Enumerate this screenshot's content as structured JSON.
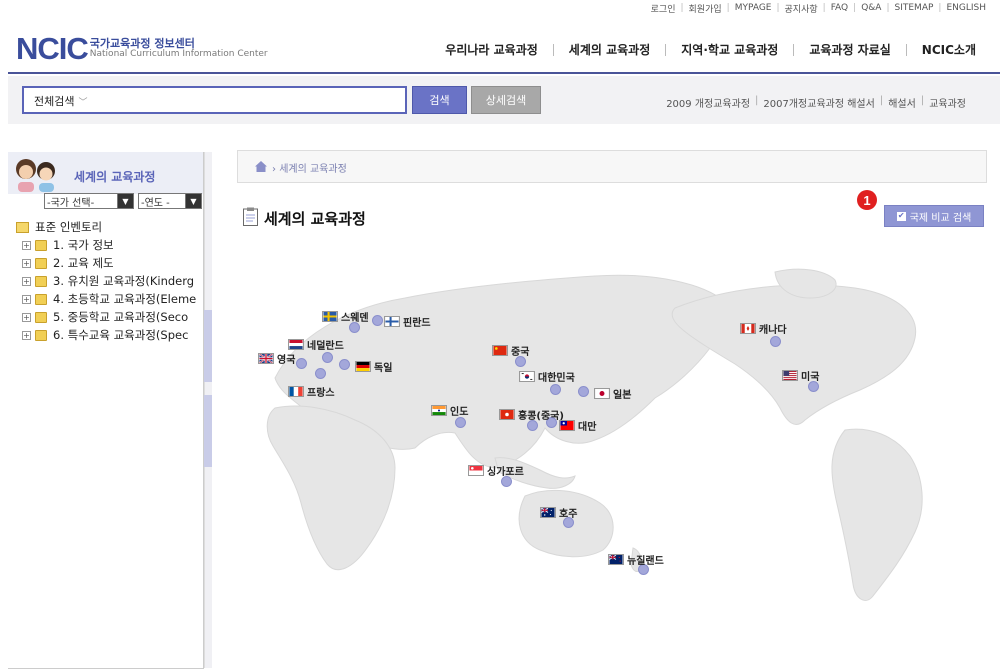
{
  "utility_nav": [
    "로그인",
    "회원가입",
    "MYPAGE",
    "공지사항",
    "FAQ",
    "Q&A",
    "SITEMAP",
    "ENGLISH"
  ],
  "logo": {
    "mark": "NCIC",
    "korean": "국가교육과정 정보센터",
    "english": "National Curriculum Information Center"
  },
  "main_nav": [
    "우리나라 교육과정",
    "세계의 교육과정",
    "지역·학교 교육과정",
    "교육과정 자료실",
    "NCIC소개"
  ],
  "search": {
    "scope": "전체검색",
    "value": "",
    "button": "검색",
    "detail_button": "상세검색"
  },
  "quick_links": [
    "2009 개정교육과정",
    "2007개정교육과정 해설서",
    "해설서",
    "교육과정"
  ],
  "left_panel": {
    "title": "세계의 교육과정",
    "country_select": "-국가 선택-",
    "year_select": "-연도 -",
    "tree_root": "표준 인벤토리",
    "tree_items": [
      "1. 국가 정보",
      "2. 교육 제도",
      "3. 유치원 교육과정(Kinderg",
      "4. 초등학교 교육과정(Eleme",
      "5. 중등학교 교육과정(Seco",
      "6. 특수교육 교육과정(Spec"
    ]
  },
  "breadcrumb": "세계의 교육과정",
  "page_title": "세계의 교육과정",
  "badge": "1",
  "compare_button": "국제 비교 검색",
  "countries": {
    "sweden": "스웨덴",
    "finland": "핀란드",
    "netherlands": "네덜란드",
    "uk": "영국",
    "germany": "독일",
    "france": "프랑스",
    "china": "중국",
    "korea": "대한민국",
    "japan": "일본",
    "india": "인도",
    "hongkong": "홍콩(중국)",
    "taiwan": "대만",
    "singapore": "싱가포르",
    "australia": "호주",
    "newzealand": "뉴질랜드",
    "canada": "캐나다",
    "usa": "미국"
  },
  "colors": {
    "brand": "#3a4d9c",
    "accent": "#6a73c6",
    "map_land": "#e6e6e6",
    "map_dot": "#a3a7da",
    "badge": "#e02020"
  }
}
